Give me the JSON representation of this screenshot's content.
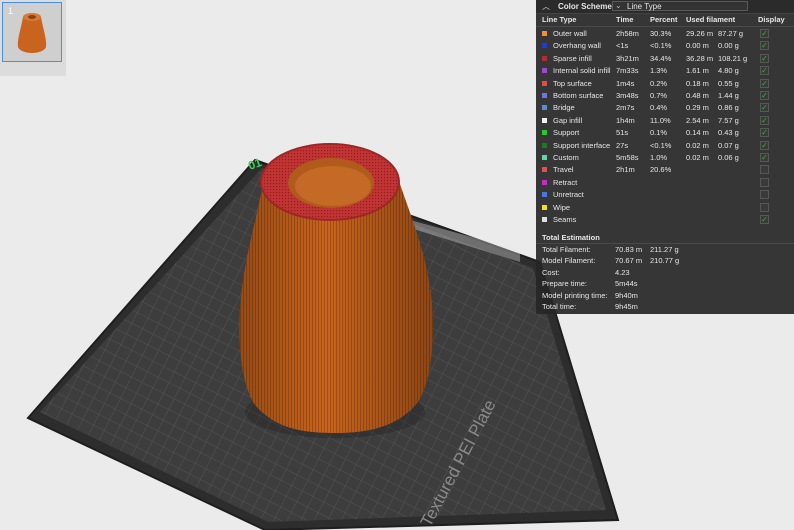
{
  "plate": {
    "label": "Textured PEI Plate",
    "corner_label": "01"
  },
  "thumbnails": [
    {
      "index": "1"
    }
  ],
  "panel": {
    "color_scheme_label": "Color Scheme",
    "selected_scheme": "Line Type",
    "columns": [
      "Line Type",
      "Time",
      "Percent",
      "Used filament",
      "Display"
    ],
    "rows": [
      {
        "name": "Outer wall",
        "color": "#f28c3c",
        "time": "2h58m",
        "percent": "30.3%",
        "length": "29.26 m",
        "weight": "87.27 g",
        "display": true
      },
      {
        "name": "Overhang wall",
        "color": "#1f3ad6",
        "time": "<1s",
        "percent": "<0.1%",
        "length": "0.00 m",
        "weight": "0.00 g",
        "display": true
      },
      {
        "name": "Sparse infill",
        "color": "#a83232",
        "time": "3h21m",
        "percent": "34.4%",
        "length": "36.28 m",
        "weight": "108.21 g",
        "display": true
      },
      {
        "name": "Internal solid infill",
        "color": "#9a4ccf",
        "time": "7m33s",
        "percent": "1.3%",
        "length": "1.61 m",
        "weight": "4.80 g",
        "display": true
      },
      {
        "name": "Top surface",
        "color": "#e84848",
        "time": "1m4s",
        "percent": "0.2%",
        "length": "0.18 m",
        "weight": "0.55 g",
        "display": true
      },
      {
        "name": "Bottom surface",
        "color": "#6e74e0",
        "time": "3m48s",
        "percent": "0.7%",
        "length": "0.48 m",
        "weight": "1.44 g",
        "display": true
      },
      {
        "name": "Bridge",
        "color": "#5a8cc8",
        "time": "2m7s",
        "percent": "0.4%",
        "length": "0.29 m",
        "weight": "0.86 g",
        "display": true
      },
      {
        "name": "Gap infill",
        "color": "#f2f2f2",
        "time": "1h4m",
        "percent": "11.0%",
        "length": "2.54 m",
        "weight": "7.57 g",
        "display": true
      },
      {
        "name": "Support",
        "color": "#2ec42e",
        "time": "51s",
        "percent": "0.1%",
        "length": "0.14 m",
        "weight": "0.43 g",
        "display": true
      },
      {
        "name": "Support interface",
        "color": "#1f7a1f",
        "time": "27s",
        "percent": "<0.1%",
        "length": "0.02 m",
        "weight": "0.07 g",
        "display": true
      },
      {
        "name": "Custom",
        "color": "#5ed6a8",
        "time": "5m58s",
        "percent": "1.0%",
        "length": "0.02 m",
        "weight": "0.06 g",
        "display": true
      },
      {
        "name": "Travel",
        "color": "#e05252",
        "time": "2h1m",
        "percent": "20.6%",
        "length": "",
        "weight": "",
        "display": false
      },
      {
        "name": "Retract",
        "color": "#c030c0",
        "time": "",
        "percent": "",
        "length": "",
        "weight": "",
        "display": false
      },
      {
        "name": "Unretract",
        "color": "#4a78d8",
        "time": "",
        "percent": "",
        "length": "",
        "weight": "",
        "display": false
      },
      {
        "name": "Wipe",
        "color": "#f0e020",
        "time": "",
        "percent": "",
        "length": "",
        "weight": "",
        "display": false
      },
      {
        "name": "Seams",
        "color": "#e0e0e0",
        "time": "",
        "percent": "",
        "length": "",
        "weight": "",
        "display": true
      }
    ],
    "check_glyph": "✓",
    "estimation": {
      "title": "Total Estimation",
      "rows": [
        {
          "label": "Total Filament:",
          "value": "70.83 m",
          "value2": "211.27 g"
        },
        {
          "label": "Model Filament:",
          "value": "70.67 m",
          "value2": "210.77 g"
        },
        {
          "label": "Cost:",
          "value": "4.23",
          "value2": ""
        },
        {
          "label": "Prepare time:",
          "value": "5m44s",
          "value2": ""
        },
        {
          "label": "Model printing time:",
          "value": "9h40m",
          "value2": ""
        },
        {
          "label": "Total time:",
          "value": "9h45m",
          "value2": ""
        }
      ]
    }
  },
  "colors": {
    "model": "#c8641e",
    "model_top": "#b83232",
    "plate": "#3e3e3e"
  }
}
